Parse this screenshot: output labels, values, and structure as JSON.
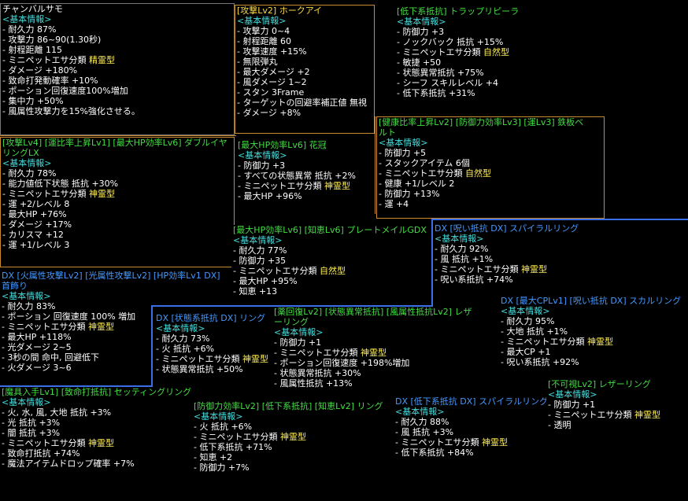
{
  "p1": {
    "title": "チャンバルサモ",
    "section": "<基本情報>",
    "stats": [
      [
        "- 耐久力 87%",
        ""
      ],
      [
        "- 攻撃力 86~90(1.30秒)",
        ""
      ],
      [
        "- 射程距離 115",
        ""
      ],
      [
        "- ミニペットエサ分類 ",
        "精霊型"
      ],
      [
        "- ダメージ +180%",
        ""
      ],
      [
        "- 致命打発動確率 +10%",
        ""
      ],
      [
        "- ポーション回復速度100%増加",
        ""
      ],
      [
        "- 集中力 +50%",
        ""
      ],
      [
        "- 風属性攻撃力を15%強化させる。",
        ""
      ]
    ]
  },
  "p2": {
    "title": "[攻撃Lv2] ホークアイ",
    "section": "<基本情報>",
    "stats": [
      [
        "- 攻撃力 0~4",
        ""
      ],
      [
        "- 射程距離 60",
        ""
      ],
      [
        "- 攻撃速度 +15%",
        ""
      ],
      [
        "- 無限弾丸",
        ""
      ],
      [
        "- 最大ダメージ +2",
        ""
      ],
      [
        "- 風ダメージ 1~2",
        ""
      ],
      [
        "- スタン 3Frame",
        ""
      ],
      [
        "- ターゲットの回避率補正値 無視",
        ""
      ],
      [
        "- ダメージ +8%",
        ""
      ]
    ]
  },
  "p3": {
    "title": "[低下系抵抗] トラップリピーラ",
    "section": "<基本情報>",
    "stats": [
      [
        "- 防御力 +3",
        ""
      ],
      [
        "- ノックバック 抵抗 +15%",
        ""
      ],
      [
        "- ミニペットエサ分類 ",
        "自然型"
      ],
      [
        "- 敏捷 +50",
        ""
      ],
      [
        "- 状態異常抵抗 +75%",
        ""
      ],
      [
        "- シーフ スキルレベル +4",
        ""
      ],
      [
        "- 低下系抵抗 +31%",
        ""
      ]
    ]
  },
  "p4": {
    "title": "[攻撃Lv4] [運比率上昇Lv1] [最大HP効率Lv6] ダブルイヤリングLX",
    "section": "<基本情報>",
    "stats": [
      [
        "- 耐久力 78%",
        ""
      ],
      [
        "- 能力値低下状態 抵抗 +30%",
        ""
      ],
      [
        "- ミニペットエサ分類 ",
        "神霊型"
      ],
      [
        "- 運 +2/レベル 8",
        ""
      ],
      [
        "- 最大HP +76%",
        ""
      ],
      [
        "- ダメージ +17%",
        ""
      ],
      [
        "- カリスマ +12",
        ""
      ],
      [
        "- 運 +1/レベル 3",
        ""
      ]
    ]
  },
  "p5": {
    "title": "[最大HP効率Lv6] 花冠",
    "section": "<基本情報>",
    "stats": [
      [
        "- 防御力 +3",
        ""
      ],
      [
        "- すべての状態異常 抵抗 +2%",
        ""
      ],
      [
        "- ミニペットエサ分類 ",
        "神霊型"
      ],
      [
        "- 最大HP +96%",
        ""
      ]
    ]
  },
  "p6": {
    "title": "[健康比率上昇Lv2] [防御力効率Lv3] [運Lv3] 鉄板ベルト",
    "section": "<基本情報>",
    "stats": [
      [
        "- 防御力 +5",
        ""
      ],
      [
        "- スタックアイテム 6個",
        ""
      ],
      [
        "- ミニペットエサ分類 ",
        "自然型"
      ],
      [
        "- 健康 +1/レベル 2",
        ""
      ],
      [
        "- 防御力 +13%",
        ""
      ],
      [
        "- 運 +4",
        ""
      ]
    ]
  },
  "p7": {
    "title": "[最大HP効率Lv6] [知恵Lv6] プレートメイルGDX",
    "section": "<基本情報>",
    "stats": [
      [
        "- 耐久力 77%",
        ""
      ],
      [
        "- 防御力 +35",
        ""
      ],
      [
        "- ミニペットエサ分類 ",
        "自然型"
      ],
      [
        "- 最大HP +95%",
        ""
      ],
      [
        "- 知恵 +13",
        ""
      ]
    ]
  },
  "p8": {
    "title": "DX [呪い抵抗 DX] スパイラルリング",
    "section": "<基本情報>",
    "stats": [
      [
        "- 耐久力 92%",
        ""
      ],
      [
        "- 風 抵抗 +1%",
        ""
      ],
      [
        "- ミニペットエサ分類 ",
        "神霊型"
      ],
      [
        "- 呪い系抵抗 +74%",
        ""
      ]
    ]
  },
  "p9": {
    "title": "DX [火属性攻撃Lv2] [光属性攻撃Lv2] [HP効率Lv1 DX] 首飾り",
    "section": "<基本情報>",
    "stats": [
      [
        "- 耐久力 83%",
        ""
      ],
      [
        "- ポーション 回復速度 100% 増加",
        ""
      ],
      [
        "- ミニペットエサ分類 ",
        "神霊型"
      ],
      [
        "- 最大HP +118%",
        ""
      ],
      [
        "- 光ダメージ 2~5",
        ""
      ],
      [
        "- 3秒の間 命中, 回避低下",
        ""
      ],
      [
        "- 火ダメージ 3~6",
        ""
      ]
    ]
  },
  "p10": {
    "title": "DX [状態系抵抗 DX] リング",
    "section": "<基本情報>",
    "stats": [
      [
        "- 耐久力 73%",
        ""
      ],
      [
        "- 火 抵抗 +6%",
        ""
      ],
      [
        "- ミニペットエサ分類 ",
        "神霊型"
      ],
      [
        "- 状態異常抵抗 +50%",
        ""
      ]
    ]
  },
  "p11": {
    "title": "[薬回復Lv2] [状態異常抵抗] [風属性抵抗Lv2] レザーリング",
    "section": "<基本情報>",
    "stats": [
      [
        "- 防御力 +1",
        ""
      ],
      [
        "- ミニペットエサ分類 ",
        "神霊型"
      ],
      [
        "- ポーション回復速度 +198%増加",
        ""
      ],
      [
        "- 状態異常抵抗 +30%",
        ""
      ],
      [
        "- 風属性抵抗 +13%",
        ""
      ]
    ]
  },
  "p12": {
    "title": "DX [最大CPLv1] [呪い抵抗 DX] スカルリング",
    "section": "<基本情報>",
    "stats": [
      [
        "- 耐久力 95%",
        ""
      ],
      [
        "- 大地 抵抗 +1%",
        ""
      ],
      [
        "- ミニペットエサ分類 ",
        "神霊型"
      ],
      [
        "- 最大CP +1",
        ""
      ],
      [
        "- 呪い系抵抗 +92%",
        ""
      ]
    ]
  },
  "p13": {
    "title": "[魔具入手Lv1] [致命打抵抗] セッティングリング",
    "section": "<基本情報>",
    "stats": [
      [
        "- 火, 水, 風, 大地 抵抗 +3%",
        ""
      ],
      [
        "- 光 抵抗 +3%",
        ""
      ],
      [
        "- 闇 抵抗 +3%",
        ""
      ],
      [
        "- ミニペットエサ分類 ",
        "神霊型"
      ],
      [
        "- 致命打抵抗 +74%",
        ""
      ],
      [
        "- 魔法アイテムドロップ確率 +7%",
        ""
      ]
    ]
  },
  "p14": {
    "title": "[防御力効率Lv2] [低下系抵抗] [知恵Lv2] リング",
    "section": "<基本情報>",
    "stats": [
      [
        "- 火 抵抗 +6%",
        ""
      ],
      [
        "- ミニペットエサ分類 ",
        "神霊型"
      ],
      [
        "- 低下系抵抗 +71%",
        ""
      ],
      [
        "- 知恵 +2",
        ""
      ],
      [
        "- 防御力 +7%",
        ""
      ]
    ]
  },
  "p15": {
    "title": "DX [低下系抵抗 DX] スパイラルリング",
    "section": "<基本情報>",
    "stats": [
      [
        "- 耐久力 88%",
        ""
      ],
      [
        "- 風 抵抗 +3%",
        ""
      ],
      [
        "- ミニペットエサ分類 ",
        "神霊型"
      ],
      [
        "- 低下系抵抗 +84%",
        ""
      ]
    ]
  },
  "p16": {
    "title": "[不可視Lv2] レザーリング",
    "section": "<基本情報>",
    "stats": [
      [
        "- 防御力 +1",
        ""
      ],
      [
        "- ミニペットエサ分類 ",
        "神霊型"
      ],
      [
        "- 透明",
        ""
      ]
    ]
  },
  "colors": {
    "section": "#44dddd",
    "title_green": "#44dd44",
    "title_blue": "#4499ff",
    "highlight": "#ffee55",
    "border_blue": "#3a6ee8",
    "border_orange": "#c88a2e"
  }
}
